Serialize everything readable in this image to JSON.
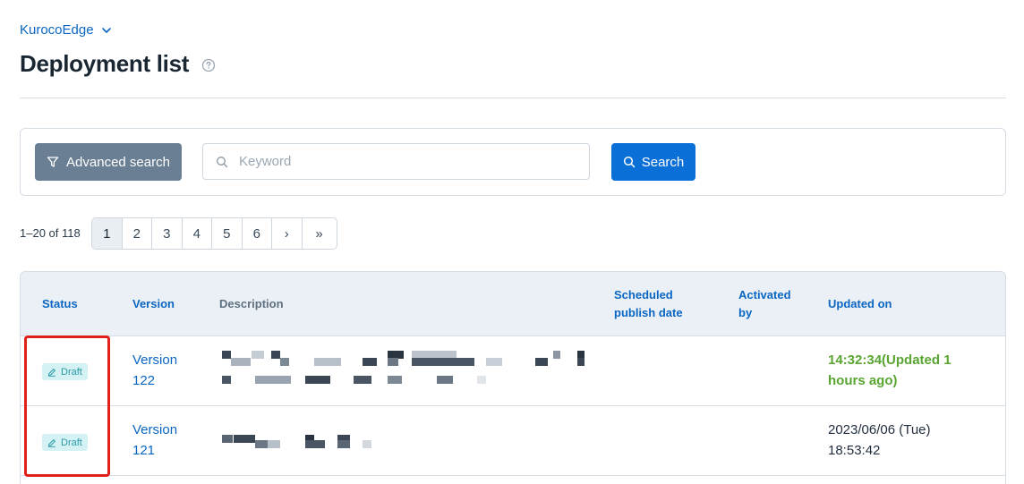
{
  "site_switcher": {
    "label": "KurocoEdge"
  },
  "page": {
    "title": "Deployment list"
  },
  "search": {
    "advanced_label": "Advanced search",
    "keyword_placeholder": "Keyword",
    "keyword_value": "",
    "search_label": "Search"
  },
  "pagination": {
    "count_text": "1–20 of 118",
    "pages": [
      "1",
      "2",
      "3",
      "4",
      "5",
      "6"
    ],
    "current": "1",
    "next": "›",
    "last": "»"
  },
  "table": {
    "columns": {
      "status": "Status",
      "version": "Version",
      "description": "Description",
      "scheduled_line1": "Scheduled",
      "scheduled_line2": "publish date",
      "activated_line1": "Activated",
      "activated_line2": "by",
      "updated": "Updated on"
    },
    "rows": [
      {
        "status": "Draft",
        "version_line1": "Version",
        "version_line2": "122",
        "updated_line1": "14:32:34(Updated 1",
        "updated_line2": "hours ago)"
      },
      {
        "status": "Draft",
        "version_line1": "Version",
        "version_line2": "121",
        "updated_line1": "2023/06/06 (Tue)",
        "updated_line2": "18:53:42"
      }
    ]
  },
  "colors": {
    "accent": "#0a66c2",
    "primary_button": "#0a6fd6",
    "secondary_button": "#6a7f93",
    "draft_badge_bg": "#d4f1f3",
    "draft_badge_text": "#2a9aa6",
    "recent_update": "#5aa532",
    "highlight": "#e0201b"
  },
  "icons": {
    "site_switcher": "chevron-down-icon",
    "help": "question-circle-icon",
    "advanced": "filter-icon",
    "keyword": "search-icon",
    "search_button": "search-icon",
    "draft": "pencil-icon"
  }
}
